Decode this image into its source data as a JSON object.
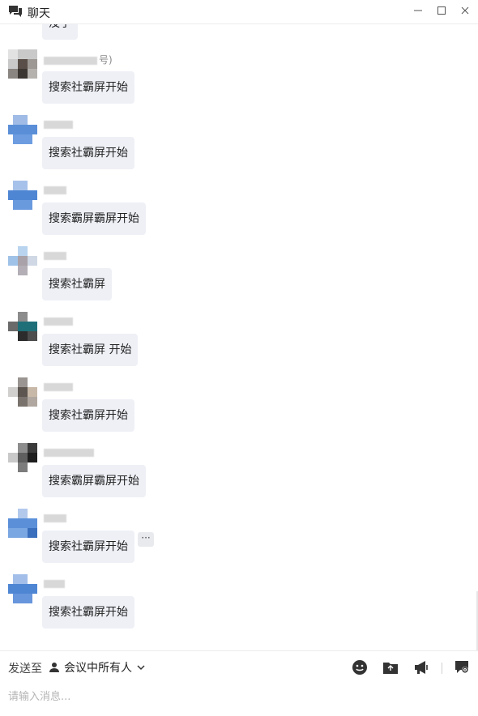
{
  "window": {
    "title": "聊天"
  },
  "messages": [
    {
      "sender_suffix": "号)",
      "text": "搜索社霸屏开始"
    },
    {
      "sender_suffix": "",
      "text": "搜索社霸屏开始"
    },
    {
      "sender_suffix": "",
      "text": "搜索霸屏霸屏开始"
    },
    {
      "sender_suffix": "",
      "text": "搜索社霸屏"
    },
    {
      "sender_suffix": "",
      "text": "搜索社霸屏 开始"
    },
    {
      "sender_suffix": "",
      "text": "搜索社霸屏开始"
    },
    {
      "sender_suffix": "",
      "text": "搜索霸屏霸屏开始"
    },
    {
      "sender_suffix": "",
      "text": "搜索社霸屏开始"
    },
    {
      "sender_suffix": "",
      "text": "搜索社霸屏开始"
    }
  ],
  "partial_top_message": {
    "text": "没了"
  },
  "more_button": {
    "label": "···"
  },
  "composer": {
    "send_to_label": "发送至",
    "recipient": "会议中所有人",
    "placeholder": "请输入消息..."
  },
  "icons": {
    "app": "chat-bubbles-icon",
    "toolbar": [
      "emoji-icon",
      "file-folder-icon",
      "megaphone-icon",
      "chat-settings-icon"
    ]
  }
}
